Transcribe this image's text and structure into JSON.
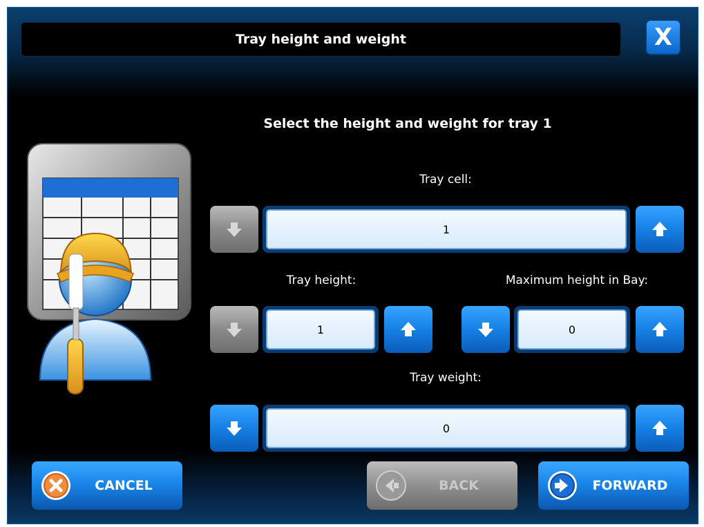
{
  "dialog": {
    "title": "Tray height and weight",
    "close_label": "X",
    "heading": "Select the height and weight for tray 1"
  },
  "fields": {
    "tray_cell": {
      "label": "Tray cell:",
      "value": "1"
    },
    "tray_height": {
      "label": "Tray height:",
      "value": "1"
    },
    "max_height_bay": {
      "label": "Maximum height in Bay:",
      "value": "0"
    },
    "tray_weight": {
      "label": "Tray weight:",
      "value": "0"
    }
  },
  "buttons": {
    "cancel": "CANCEL",
    "back": "BACK",
    "forward": "FORWARD"
  },
  "colors": {
    "accent_blue": "#1680e6",
    "disabled_gray": "#8a8a8a",
    "field_background": "#e6f2fd"
  }
}
